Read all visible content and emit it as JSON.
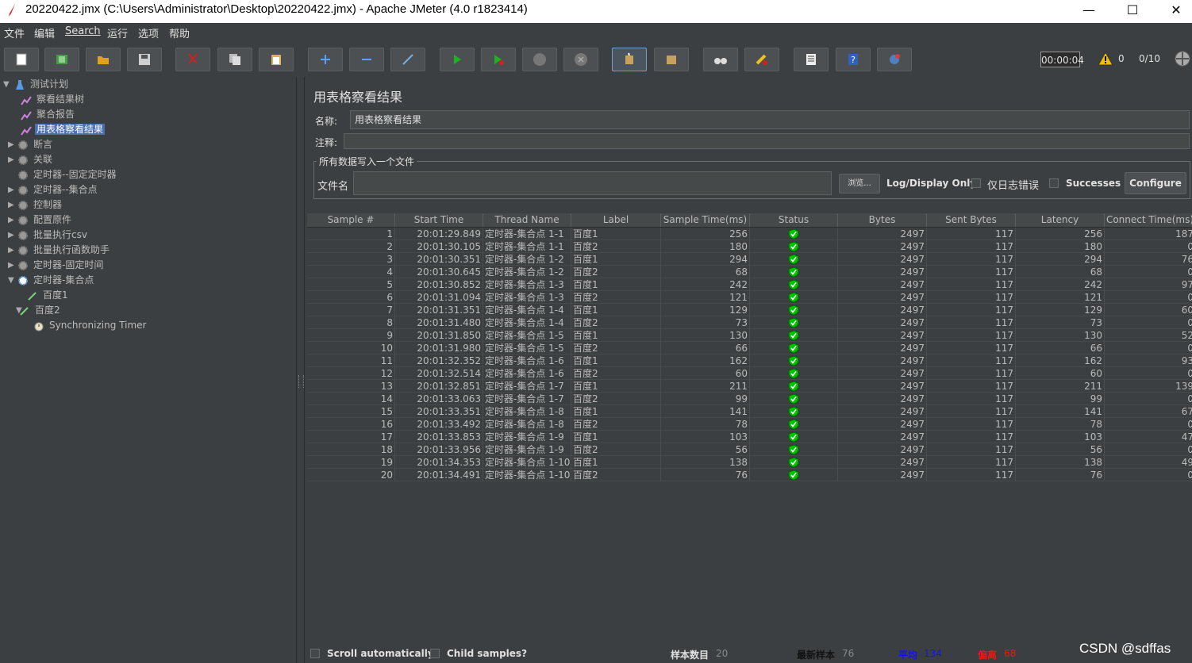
{
  "window": {
    "title": "20220422.jmx (C:\\Users\\Administrator\\Desktop\\20220422.jmx) - Apache JMeter (4.0 r1823414)",
    "minimize": "—",
    "maximize": "☐",
    "close": "✕"
  },
  "menu": [
    "文件",
    "编辑",
    "Search",
    "运行",
    "选项",
    "帮助"
  ],
  "toolbar": {
    "buttons": [
      "new-icon",
      "templates-icon",
      "open-icon",
      "save-icon",
      "cut-icon",
      "copy-icon",
      "paste-icon",
      "expand-icon",
      "collapse-icon",
      "toggle-icon",
      "start-icon",
      "start-no-pause-icon",
      "stop-icon",
      "shutdown-icon",
      "clear-icon",
      "clear-all-icon",
      "search-icon",
      "reset-search-icon",
      "function-helper-icon",
      "help-icon",
      "remote-icon"
    ],
    "timer": "00:00:04",
    "warnings": "0",
    "threads": "0/10"
  },
  "tree": {
    "root": "测试计划",
    "items": [
      {
        "label": "察看结果树"
      },
      {
        "label": "聚合报告"
      },
      {
        "label": "用表格察看结果"
      },
      {
        "label": "断言"
      },
      {
        "label": "关联"
      },
      {
        "label": "定时器--固定定时器"
      },
      {
        "label": "定时器--集合点"
      },
      {
        "label": "控制器"
      },
      {
        "label": "配置原件"
      },
      {
        "label": "批量执行csv"
      },
      {
        "label": "批量执行函数助手"
      },
      {
        "label": "定时器-固定时间"
      },
      {
        "label": "定时器-集合点"
      },
      {
        "label": "百度1"
      },
      {
        "label": "百度2"
      },
      {
        "label": "Synchronizing Timer"
      }
    ]
  },
  "panel": {
    "title": "用表格察看结果",
    "name_label": "名称:",
    "name_value": "用表格察看结果",
    "comment_label": "注释:",
    "comment_value": "",
    "file_group_title": "所有数据写入一个文件",
    "filename_label": "文件名",
    "filename_value": "",
    "browse": "浏览...",
    "log_display_only": "Log/Display Only:",
    "errors_only": "仅日志错误",
    "successes": "Successes",
    "configure": "Configure"
  },
  "table": {
    "columns": [
      "Sample #",
      "Start Time",
      "Thread Name",
      "Label",
      "Sample Time(ms)",
      "Status",
      "Bytes",
      "Sent Bytes",
      "Latency",
      "Connect Time(ms)"
    ],
    "rows": [
      [
        "1",
        "20:01:29.849",
        "定时器-集合点 1-1",
        "百度1",
        "256",
        "ok",
        "2497",
        "117",
        "256",
        "187"
      ],
      [
        "2",
        "20:01:30.105",
        "定时器-集合点 1-1",
        "百度2",
        "180",
        "ok",
        "2497",
        "117",
        "180",
        "0"
      ],
      [
        "3",
        "20:01:30.351",
        "定时器-集合点 1-2",
        "百度1",
        "294",
        "ok",
        "2497",
        "117",
        "294",
        "76"
      ],
      [
        "4",
        "20:01:30.645",
        "定时器-集合点 1-2",
        "百度2",
        "68",
        "ok",
        "2497",
        "117",
        "68",
        "0"
      ],
      [
        "5",
        "20:01:30.852",
        "定时器-集合点 1-3",
        "百度1",
        "242",
        "ok",
        "2497",
        "117",
        "242",
        "97"
      ],
      [
        "6",
        "20:01:31.094",
        "定时器-集合点 1-3",
        "百度2",
        "121",
        "ok",
        "2497",
        "117",
        "121",
        "0"
      ],
      [
        "7",
        "20:01:31.351",
        "定时器-集合点 1-4",
        "百度1",
        "129",
        "ok",
        "2497",
        "117",
        "129",
        "60"
      ],
      [
        "8",
        "20:01:31.480",
        "定时器-集合点 1-4",
        "百度2",
        "73",
        "ok",
        "2497",
        "117",
        "73",
        "0"
      ],
      [
        "9",
        "20:01:31.850",
        "定时器-集合点 1-5",
        "百度1",
        "130",
        "ok",
        "2497",
        "117",
        "130",
        "52"
      ],
      [
        "10",
        "20:01:31.980",
        "定时器-集合点 1-5",
        "百度2",
        "66",
        "ok",
        "2497",
        "117",
        "66",
        "0"
      ],
      [
        "11",
        "20:01:32.352",
        "定时器-集合点 1-6",
        "百度1",
        "162",
        "ok",
        "2497",
        "117",
        "162",
        "93"
      ],
      [
        "12",
        "20:01:32.514",
        "定时器-集合点 1-6",
        "百度2",
        "60",
        "ok",
        "2497",
        "117",
        "60",
        "0"
      ],
      [
        "13",
        "20:01:32.851",
        "定时器-集合点 1-7",
        "百度1",
        "211",
        "ok",
        "2497",
        "117",
        "211",
        "139"
      ],
      [
        "14",
        "20:01:33.063",
        "定时器-集合点 1-7",
        "百度2",
        "99",
        "ok",
        "2497",
        "117",
        "99",
        "0"
      ],
      [
        "15",
        "20:01:33.351",
        "定时器-集合点 1-8",
        "百度1",
        "141",
        "ok",
        "2497",
        "117",
        "141",
        "67"
      ],
      [
        "16",
        "20:01:33.492",
        "定时器-集合点 1-8",
        "百度2",
        "78",
        "ok",
        "2497",
        "117",
        "78",
        "0"
      ],
      [
        "17",
        "20:01:33.853",
        "定时器-集合点 1-9",
        "百度1",
        "103",
        "ok",
        "2497",
        "117",
        "103",
        "47"
      ],
      [
        "18",
        "20:01:33.956",
        "定时器-集合点 1-9",
        "百度2",
        "56",
        "ok",
        "2497",
        "117",
        "56",
        "0"
      ],
      [
        "19",
        "20:01:34.353",
        "定时器-集合点 1-10",
        "百度1",
        "138",
        "ok",
        "2497",
        "117",
        "138",
        "49"
      ],
      [
        "20",
        "20:01:34.491",
        "定时器-集合点 1-10",
        "百度2",
        "76",
        "ok",
        "2497",
        "117",
        "76",
        "0"
      ]
    ]
  },
  "footer": {
    "scroll_auto": "Scroll automatically?",
    "child_samples": "Child samples?",
    "sample_count_label": "样本数目",
    "sample_count": "20",
    "latest_label": "最新样本",
    "latest": "76",
    "average_label": "平均",
    "average": "134",
    "deviation_label": "偏离",
    "deviation": "68"
  },
  "watermark": "CSDN @sdffas",
  "colors": {
    "selection": "#4b6eaf",
    "average": "#1010ff",
    "deviation": "#ff1010",
    "status_ok": "#00c000"
  }
}
